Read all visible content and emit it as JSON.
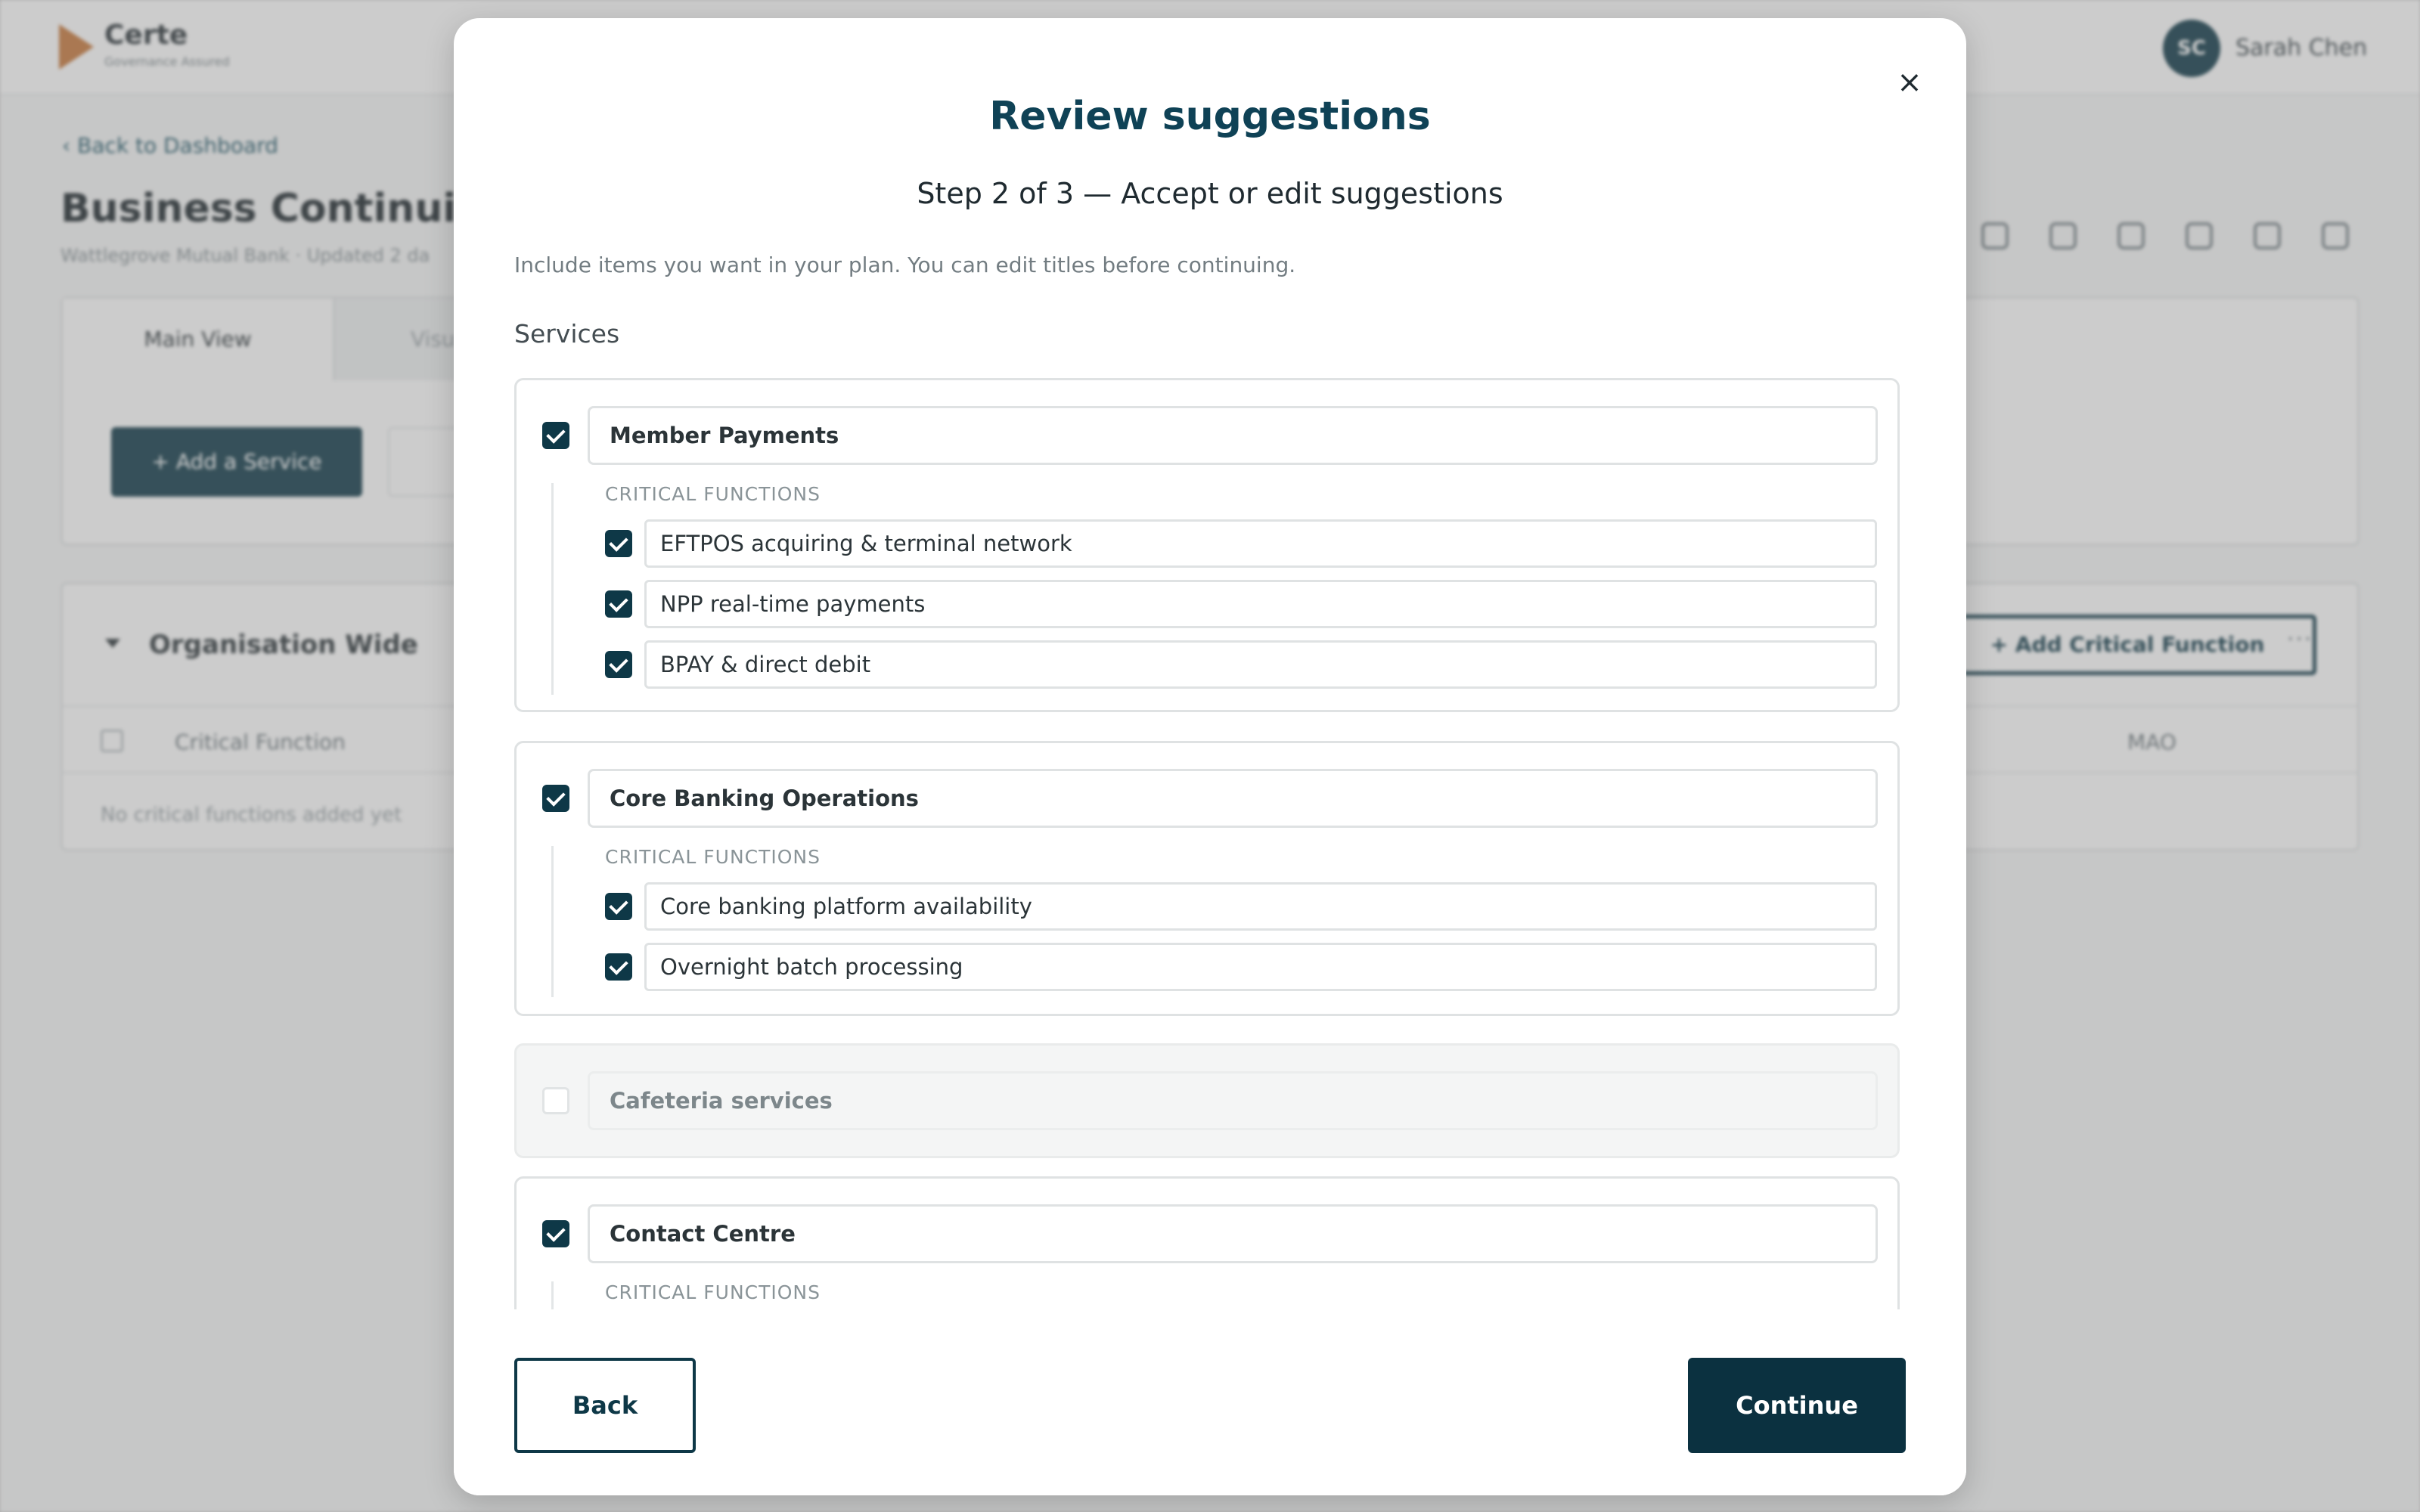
{
  "background": {
    "logo": {
      "name": "Certe",
      "tagline": "Governance Assured"
    },
    "user": {
      "initials": "SC",
      "name": "Sarah Chen"
    },
    "back_link": "Back to Dashboard",
    "page_title": "Business Continuity P",
    "page_subtitle": "Wattlegrove Mutual Bank · Updated 2 da",
    "tabs": [
      "Main View",
      "Visu"
    ],
    "add_service_label": "+  Add a Service",
    "group": {
      "title": "Organisation Wide",
      "add_critical_function_label": "+  Add Critical Function",
      "columns": [
        "Critical Function",
        "MAO"
      ],
      "empty_text": "No critical functions added yet"
    }
  },
  "modal": {
    "title": "Review suggestions",
    "close_label": "×",
    "step_text": "Step 2 of 3 — Accept or edit suggestions",
    "description": "Include items you want in your plan. You can edit titles before continuing.",
    "section_label": "Services",
    "critical_functions_heading": "CRITICAL FUNCTIONS",
    "services": [
      {
        "name": "Member Payments",
        "checked": true,
        "critical_functions": [
          {
            "name": "EFTPOS acquiring & terminal network",
            "checked": true
          },
          {
            "name": "NPP real-time payments",
            "checked": true
          },
          {
            "name": "BPAY & direct debit",
            "checked": true
          }
        ]
      },
      {
        "name": "Core Banking Operations",
        "checked": true,
        "critical_functions": [
          {
            "name": "Core banking platform availability",
            "checked": true
          },
          {
            "name": "Overnight batch processing",
            "checked": true
          }
        ]
      },
      {
        "name": "Cafeteria services",
        "checked": false,
        "critical_functions": []
      },
      {
        "name": "Contact Centre",
        "checked": true,
        "critical_functions": []
      }
    ],
    "back_label": "Back",
    "continue_label": "Continue"
  },
  "colors": {
    "primary": "#0e3847",
    "title": "#0f4256",
    "accent": "#c8783a"
  }
}
